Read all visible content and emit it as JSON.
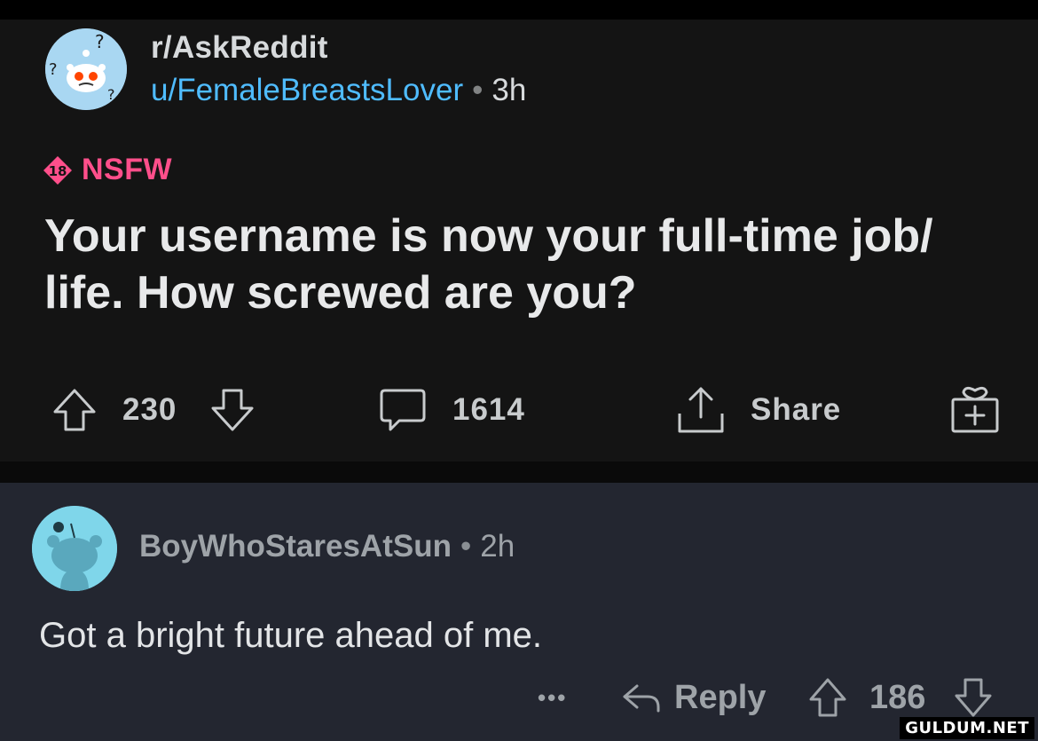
{
  "post": {
    "subreddit": "r/AskReddit",
    "author": "u/FemaleBreastsLover",
    "separator": "•",
    "age": "3h",
    "nsfw_badge": "18",
    "nsfw_label": "NSFW",
    "title": "Your username is now your full-time job/ life. How screwed are you?",
    "upvotes": "230",
    "comments": "1614",
    "share_label": "Share"
  },
  "comment": {
    "author": "BoyWhoStaresAtSun",
    "separator": "•",
    "age": "2h",
    "body": "Got a bright future ahead of me.",
    "more_label": "•••",
    "reply_label": "Reply",
    "score": "186"
  },
  "watermark": "GULDUM.NET",
  "colors": {
    "post_bg": "#141414",
    "comment_bg": "#232630",
    "username_link": "#4fbcff",
    "nsfw": "#ff4f8b"
  },
  "icons": [
    "snoo-question-avatar",
    "nsfw-18-icon",
    "upvote-icon",
    "downvote-icon",
    "comment-icon",
    "share-icon",
    "award-icon",
    "snoo-avatar",
    "reply-icon"
  ]
}
